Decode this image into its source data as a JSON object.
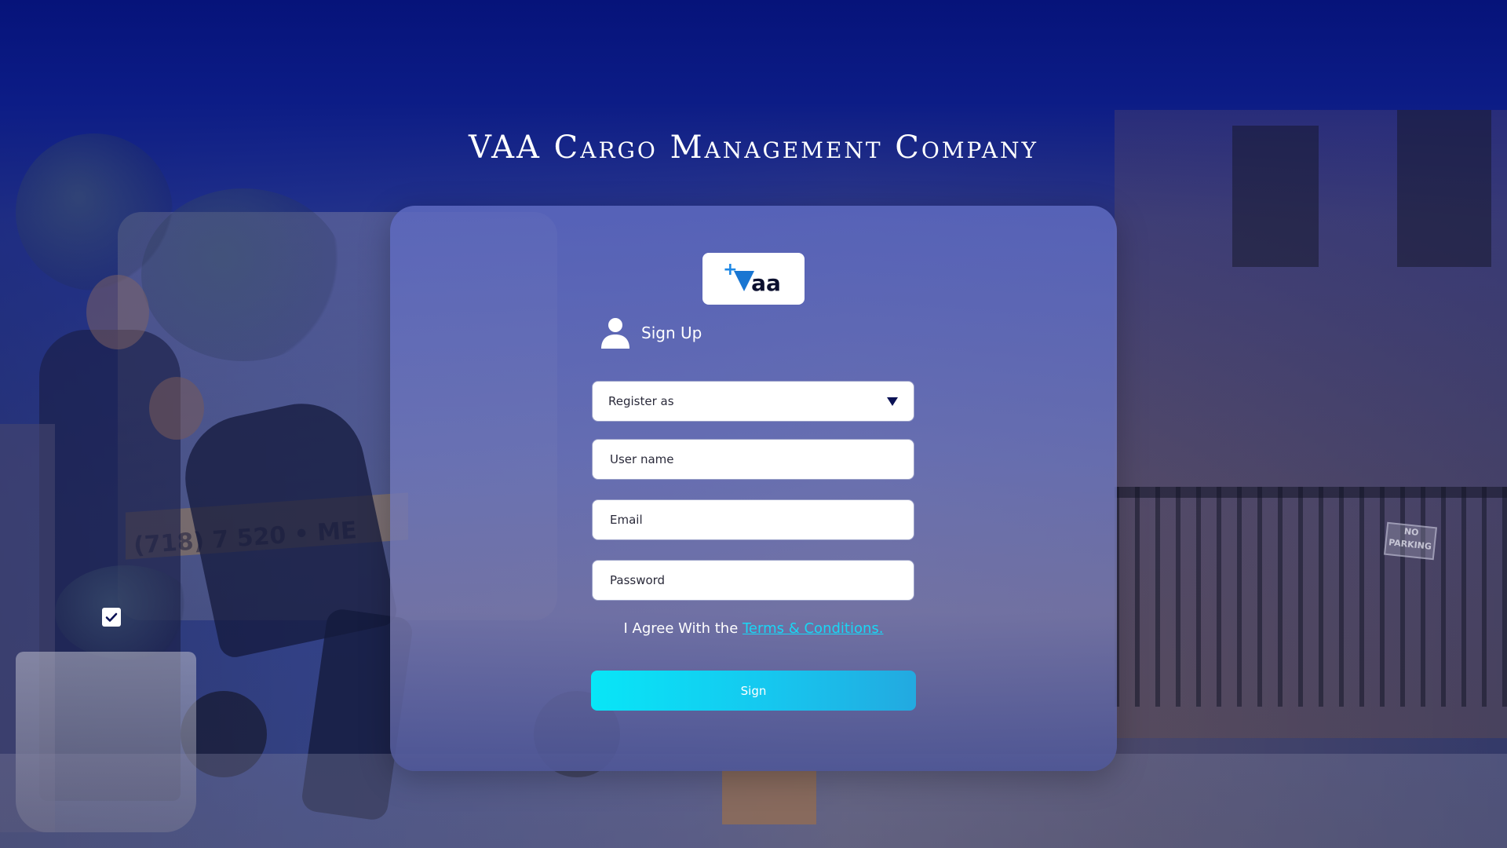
{
  "page": {
    "title": "VAA Cargo Management Company"
  },
  "scene": {
    "truck_text": "(718) 7 520 • ME",
    "no_parking_sign": "NO PARKING"
  },
  "logo": {
    "plus": "+",
    "text": "aa"
  },
  "form": {
    "heading": "Sign Up",
    "register_as": {
      "placeholder": "Register as"
    },
    "username": {
      "placeholder": "User name",
      "value": ""
    },
    "email": {
      "placeholder": "Email",
      "value": ""
    },
    "password": {
      "placeholder": "Password",
      "value": ""
    },
    "terms_prefix": "I Agree With the ",
    "terms_link": "Terms & Conditions.",
    "submit_label": "Sign"
  },
  "checkbox": {
    "checked": true
  },
  "colors": {
    "accent": "#19d7f5",
    "button_start": "#08e6f7",
    "button_end": "#23a9e0",
    "background_top": "#06137a"
  }
}
